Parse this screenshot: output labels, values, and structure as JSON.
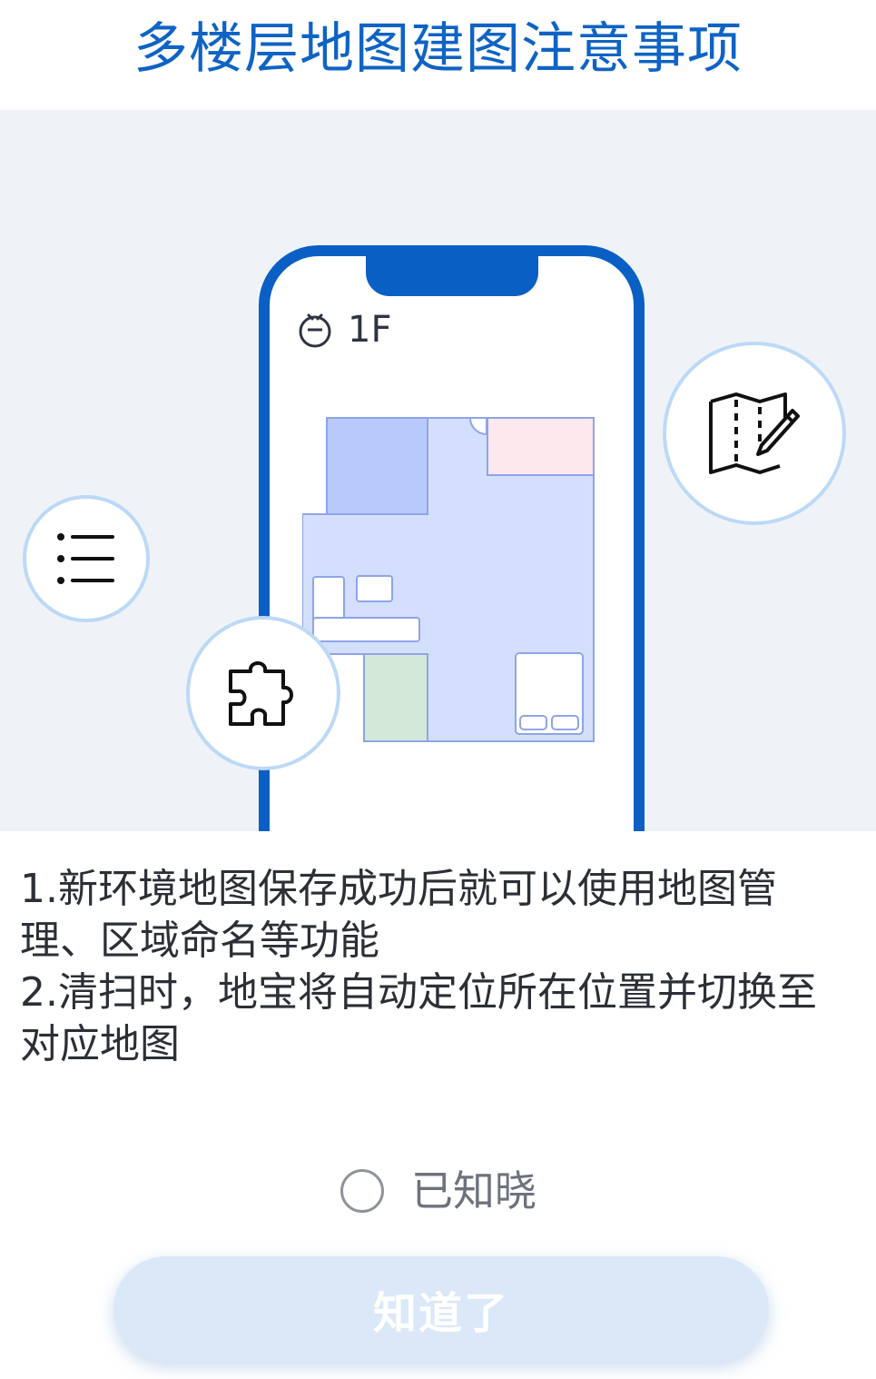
{
  "header": {
    "title": "多楼层地图建图注意事项"
  },
  "phone": {
    "floor_label": "1F",
    "robot_icon": "robot-vacuum-icon"
  },
  "bubbles": [
    {
      "icon": "list-icon"
    },
    {
      "icon": "puzzle-icon"
    },
    {
      "icon": "map-edit-icon"
    }
  ],
  "notes": [
    "1.新环境地图保存成功后就可以使用地图管理、区域命名等功能",
    "2.清扫时，地宝将自动定位所在位置并切换至对应地图"
  ],
  "acknowledge": {
    "label": "已知晓",
    "checked": false
  },
  "button": {
    "label": "知道了"
  },
  "colors": {
    "accent": "#0a5fc4",
    "title": "#0f63c4",
    "illustration_bg": "#eff3f7",
    "bubble_border": "#bcd9f6",
    "button_bg": "#dbe8f7"
  }
}
